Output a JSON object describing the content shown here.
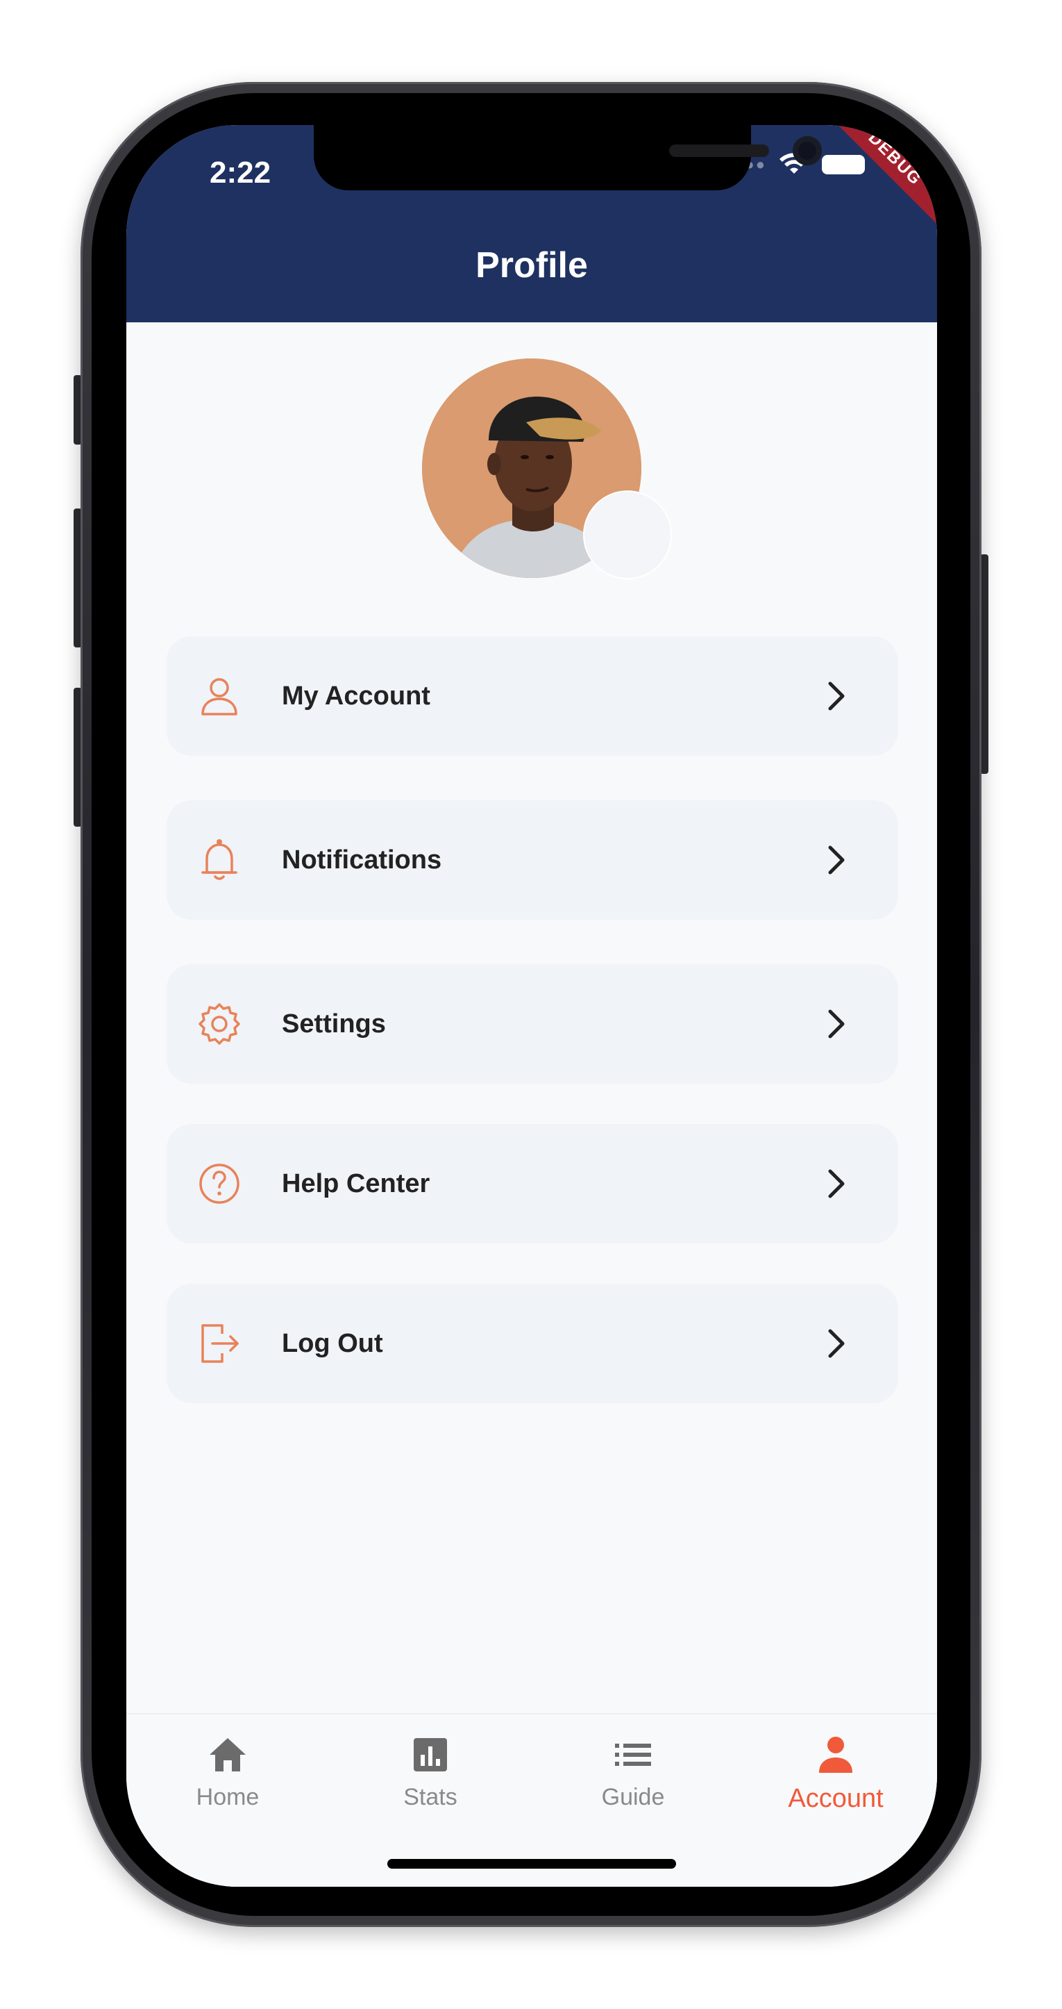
{
  "status_bar": {
    "time": "2:22",
    "debug_banner": "DEBUG"
  },
  "header": {
    "title": "Profile"
  },
  "menu": {
    "items": [
      {
        "label": "My Account",
        "icon": "user-icon"
      },
      {
        "label": "Notifications",
        "icon": "bell-icon"
      },
      {
        "label": "Settings",
        "icon": "gear-icon"
      },
      {
        "label": "Help Center",
        "icon": "help-circle-icon"
      },
      {
        "label": "Log Out",
        "icon": "log-out-icon"
      }
    ]
  },
  "bottom_nav": {
    "items": [
      {
        "label": "Home",
        "icon": "home-icon",
        "active": false
      },
      {
        "label": "Stats",
        "icon": "stats-icon",
        "active": false
      },
      {
        "label": "Guide",
        "icon": "list-icon",
        "active": false
      },
      {
        "label": "Account",
        "icon": "person-icon",
        "active": true
      }
    ]
  },
  "colors": {
    "app_bar": "#1f3161",
    "accent": "#f05a3a",
    "icon_orange": "#e8825a",
    "menu_item_bg": "#f0f3f7",
    "inactive_nav": "#8a8a8a"
  }
}
